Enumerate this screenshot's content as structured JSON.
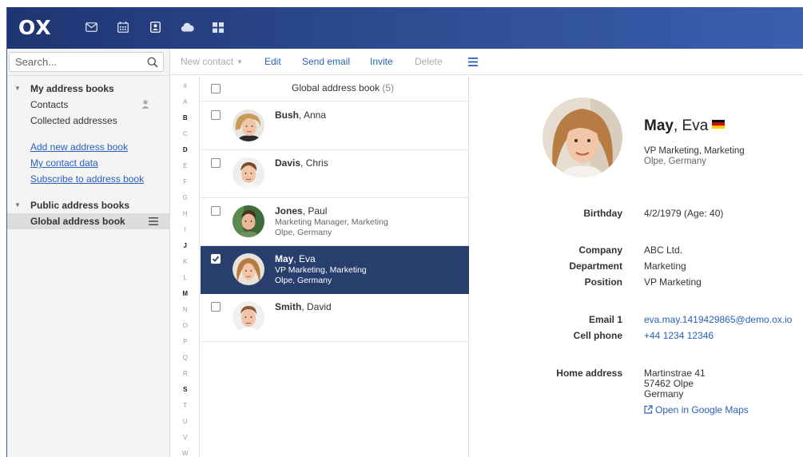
{
  "app": {
    "logo": "OX",
    "apps": [
      "mail-icon",
      "calendar-icon",
      "address-book-icon",
      "cloud-icon",
      "apps-grid-icon"
    ]
  },
  "sidebar": {
    "search_placeholder": "Search...",
    "my_books": {
      "title": "My address books",
      "items": [
        "Contacts",
        "Collected addresses"
      ]
    },
    "links": [
      "Add new address book",
      "My contact data",
      "Subscribe to address book"
    ],
    "public_books": {
      "title": "Public address books",
      "items": [
        "Global address book"
      ]
    }
  },
  "toolbar": {
    "new_contact": "New contact",
    "edit": "Edit",
    "send_email": "Send email",
    "invite": "Invite",
    "delete": "Delete"
  },
  "letters": [
    "#",
    "A",
    "B",
    "C",
    "D",
    "E",
    "F",
    "G",
    "H",
    "I",
    "J",
    "K",
    "L",
    "M",
    "N",
    "O",
    "P",
    "Q",
    "R",
    "S",
    "T",
    "U",
    "V",
    "W"
  ],
  "active_letters": [
    "B",
    "D",
    "J",
    "M",
    "S"
  ],
  "list": {
    "title": "Global address book",
    "count": "(5)",
    "contacts": [
      {
        "last": "Bush",
        "first": ", Anna",
        "line1": "",
        "line2": "",
        "selected": false
      },
      {
        "last": "Davis",
        "first": ", Chris",
        "line1": "",
        "line2": "",
        "selected": false
      },
      {
        "last": "Jones",
        "first": ", Paul",
        "line1": "Marketing Manager, Marketing",
        "line2": "Olpe, Germany",
        "selected": false
      },
      {
        "last": "May",
        "first": ", Eva",
        "line1": "VP Marketing, Marketing",
        "line2": "Olpe, Germany",
        "selected": true
      },
      {
        "last": "Smith",
        "first": ", David",
        "line1": "",
        "line2": "",
        "selected": false
      }
    ]
  },
  "detail": {
    "last": "May",
    "first": ", Eva",
    "title": "VP Marketing, Marketing",
    "location": "Olpe, Germany",
    "birthday_label": "Birthday",
    "birthday": "4/2/1979 (Age: 40)",
    "company_label": "Company",
    "company": "ABC Ltd.",
    "department_label": "Department",
    "department": "Marketing",
    "position_label": "Position",
    "position": "VP Marketing",
    "email_label": "Email 1",
    "email": "eva.may.1419429865@demo.ox.io",
    "phone_label": "Cell phone",
    "phone": "+44 1234 12346",
    "address_label": "Home address",
    "address_line1": "Martinstrae 41",
    "address_line2": "57462 Olpe",
    "address_line3": "Germany",
    "maps_link": "Open in Google Maps"
  },
  "colors": {
    "topbar": "#2c4a8f",
    "selection": "#283f6e",
    "link": "#2a61b8"
  }
}
